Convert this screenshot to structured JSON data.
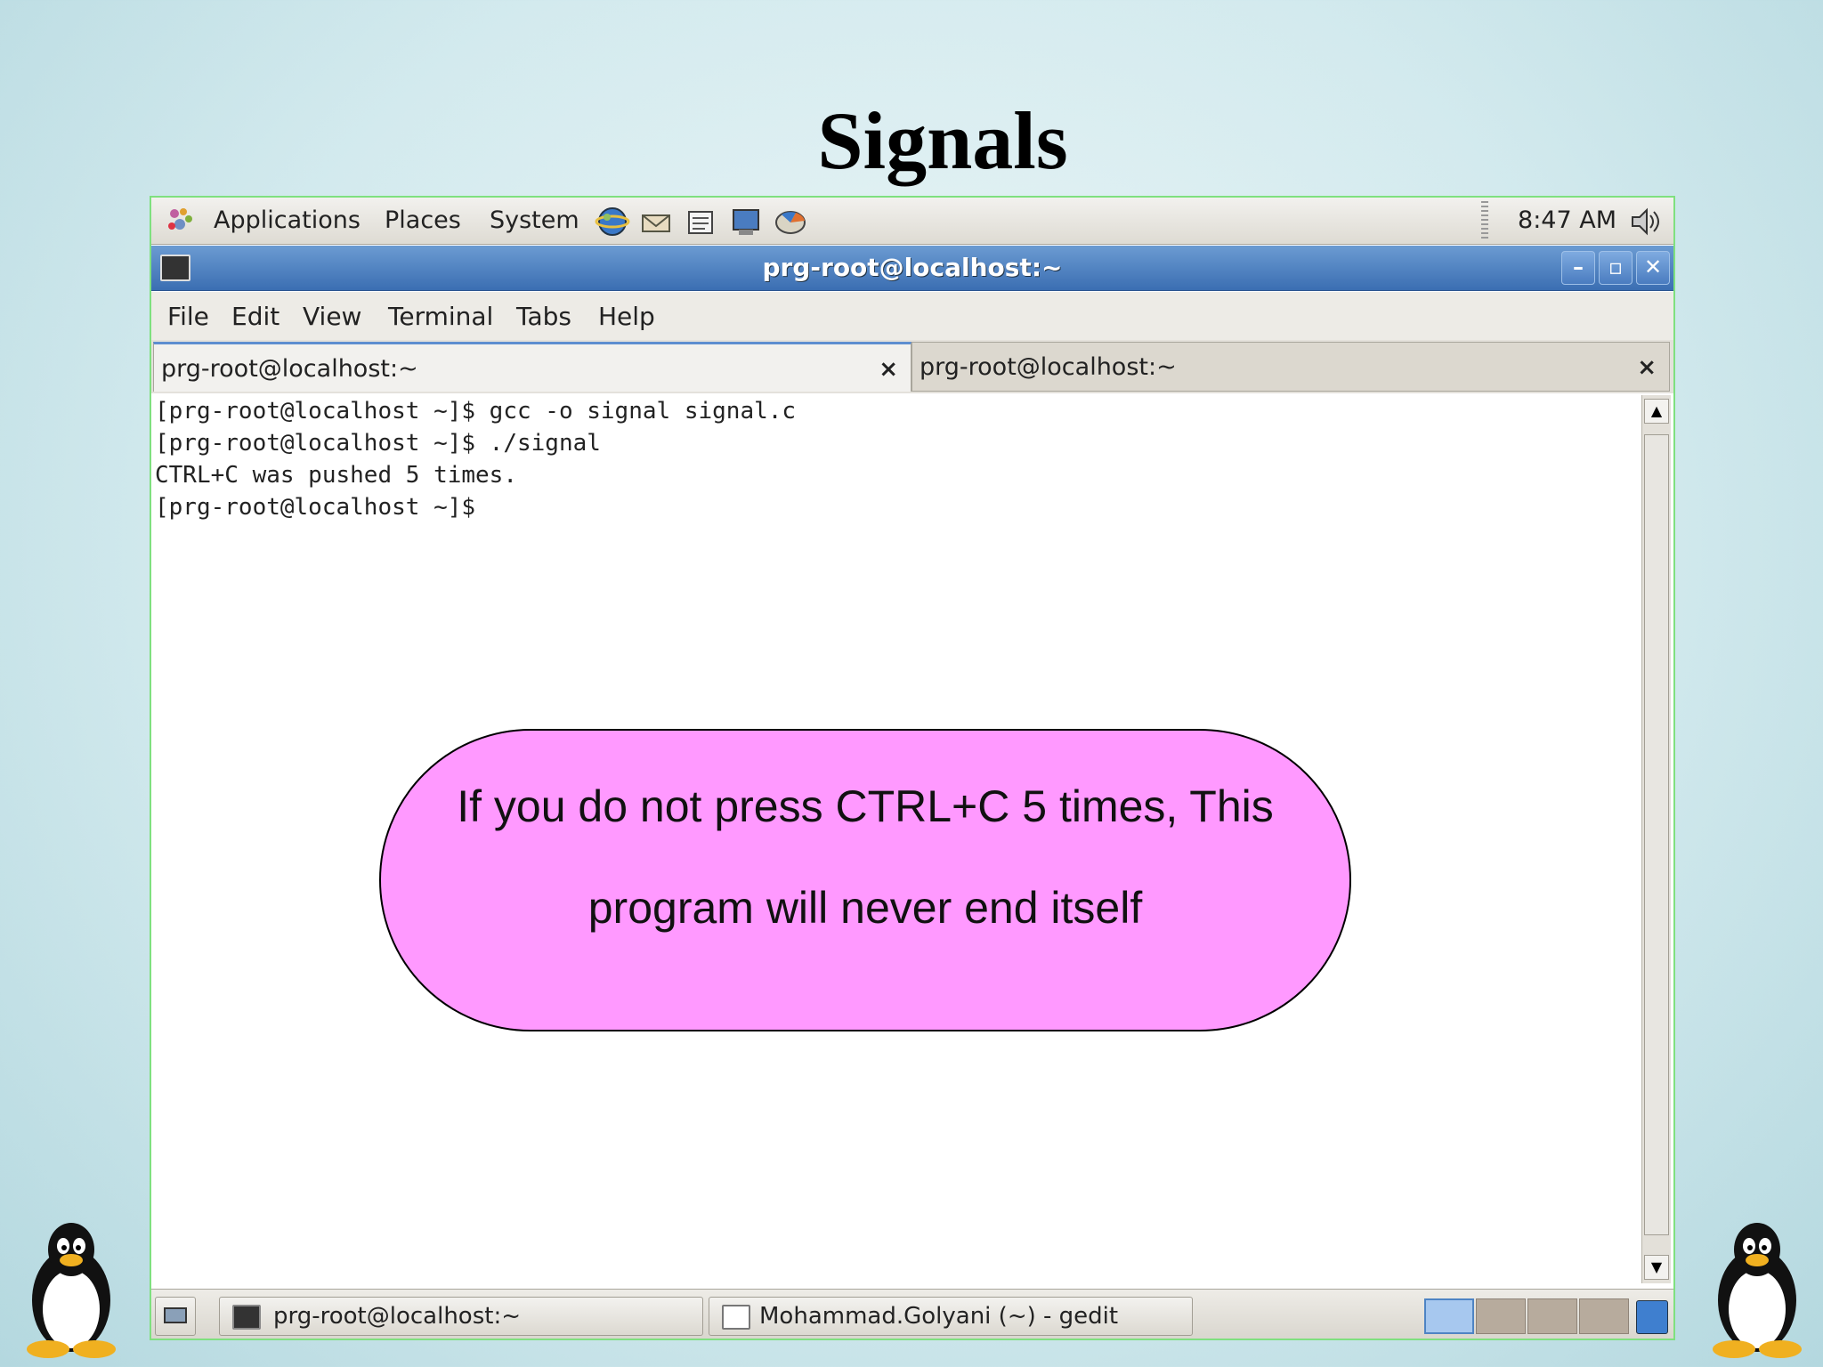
{
  "slide": {
    "title": "Signals"
  },
  "panel": {
    "menus": [
      "Applications",
      "Places",
      "System"
    ],
    "clock": "8:47 AM",
    "launchers": [
      "web-browser-icon",
      "mail-icon",
      "editor-icon",
      "screenshot-icon",
      "settings-icon"
    ]
  },
  "window": {
    "title": "prg-root@localhost:~"
  },
  "menubar": [
    "File",
    "Edit",
    "View",
    "Terminal",
    "Tabs",
    "Help"
  ],
  "tabs": [
    {
      "label": "prg-root@localhost:~",
      "active": true
    },
    {
      "label": "prg-root@localhost:~",
      "active": false
    }
  ],
  "terminal": {
    "lines": [
      "[prg-root@localhost ~]$ gcc -o signal signal.c",
      "[prg-root@localhost ~]$ ./signal",
      "CTRL+C was pushed 5 times.",
      "[prg-root@localhost ~]$ "
    ]
  },
  "taskbar": {
    "tasks": [
      {
        "label": "prg-root@localhost:~",
        "icon": "terminal-icon"
      },
      {
        "label": "Mohammad.Golyani (~) - gedit",
        "icon": "gedit-icon"
      }
    ],
    "workspaces": 4,
    "active_workspace": 1
  },
  "callout": {
    "line1": "If you do not press CTRL+C 5 times, This",
    "line2": "program will never end itself"
  },
  "colors": {
    "callout_fill": "#ff99ff",
    "titlebar": "#4a7cc0",
    "panel": "#e6e4de"
  }
}
